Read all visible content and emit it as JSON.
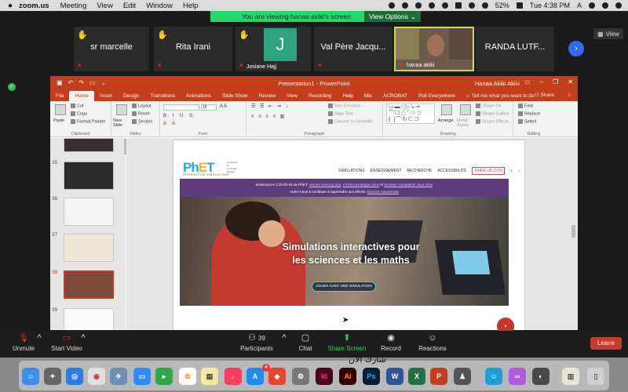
{
  "menubar": {
    "app": "zoom.us",
    "items": [
      "Meeting",
      "View",
      "Edit",
      "Window",
      "Help"
    ],
    "battery": "52%",
    "clock": "Tue 4:38 PM",
    "input_source": "A"
  },
  "sharebar": {
    "text": "You are viewing hanaa akiki's screen",
    "view_options": "View Options"
  },
  "participants": [
    {
      "name": "sr marcelle",
      "raised_hand": true
    },
    {
      "name": "Rita Irani",
      "raised_hand": true
    },
    {
      "name": "Josiane Hajj",
      "raised_hand": true,
      "initial": "J"
    },
    {
      "name": "Val Père Jacqu...",
      "raised_hand": false
    },
    {
      "name": "hanaa akiki",
      "raised_hand": false,
      "video": true
    },
    {
      "name": "RANDA LUTF...",
      "raised_hand": false
    }
  ],
  "view_button": "View",
  "ppt": {
    "title": "Presentation1 - PowerPoint",
    "user": "Hanaa Akiki Akiki",
    "tabs": [
      "File",
      "Home",
      "Insert",
      "Design",
      "Transitions",
      "Animations",
      "Slide Show",
      "Review",
      "View",
      "Recording",
      "Help",
      "Mix",
      "ACROBAT",
      "Poll Everywhere"
    ],
    "active_tab": "Home",
    "tell_me": "Tell me what you want to do",
    "share": "Share",
    "ribbon": {
      "clipboard": {
        "label": "Clipboard",
        "paste": "Paste",
        "cut": "Cut",
        "copy": "Copy",
        "format_painter": "Format Painter"
      },
      "slides": {
        "label": "Slides",
        "new_slide": "New Slide",
        "layout": "Layout",
        "reset": "Reset",
        "section": "Section"
      },
      "font": {
        "label": "Font",
        "size": "18"
      },
      "paragraph": {
        "label": "Paragraph",
        "text_direction": "Text Direction",
        "align_text": "Align Text",
        "convert": "Convert to SmartArt"
      },
      "drawing": {
        "label": "Drawing",
        "arrange": "Arrange",
        "quick_styles": "Quick Styles",
        "shape_fill": "Shape Fill",
        "shape_outline": "Shape Outline",
        "shape_effects": "Shape Effects"
      },
      "editing": {
        "label": "Editing",
        "find": "Find",
        "replace": "Replace",
        "select": "Select"
      }
    },
    "slide_numbers": [
      "35",
      "36",
      "37",
      "38",
      "39"
    ],
    "selected_slide": "38"
  },
  "slide": {
    "logo": "PhET",
    "logo_sub": "INTERACTIVE SIMULATIONS",
    "cu_text": "University of Colorado Boulder",
    "nav": [
      "SIMULATIONS",
      "ENSEIGNEMENT",
      "RECHERCHE",
      "ACCESSIBILITÉ"
    ],
    "donate": "FAIRE UN DON",
    "banner_line1_a": "Ressources COVID-19 de PhET:",
    "banner_link1": "remote learning tips",
    "banner_sep": ",",
    "banner_link2": "HTML5 prototype sims",
    "banner_and": "et",
    "banner_link3": "browser-compatible Java sims",
    "banner_line2": "Aidez-nous à continuer à apprendre aux élèves.",
    "banner_link4": "Donnez maintenant",
    "hero_title": "Simulations interactives pour les sciences et les maths",
    "hero_button": "JOUER AVEC UNE SIMULATION"
  },
  "zoom_controls": {
    "unmute": "Unmute",
    "start_video": "Start Video",
    "participants": "Participants",
    "participant_count": "39",
    "chat": "Chat",
    "share_screen": "Share Screen",
    "record": "Record",
    "reactions": "Reactions",
    "leave": "Leave"
  },
  "dock_badge": "4",
  "arabic_text": "شارك الآن"
}
